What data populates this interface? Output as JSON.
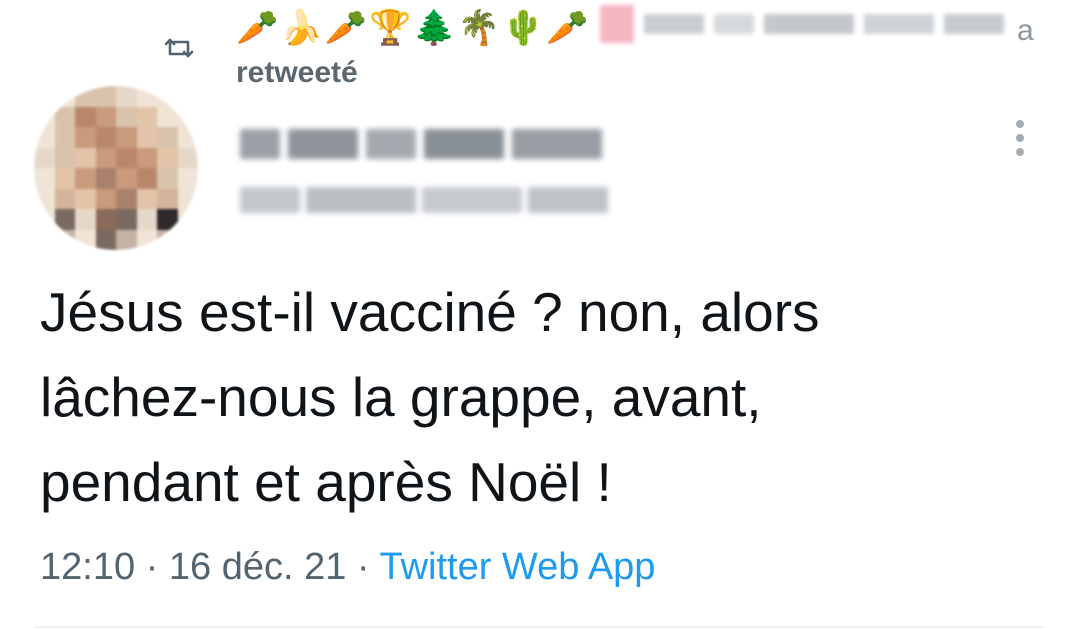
{
  "retweet": {
    "emoji_string": "🥕🍌🥕🏆🌲🌴🌵🥕",
    "tail_letter": "a",
    "label": "retweeté"
  },
  "tweet": {
    "text": "Jésus est-il vacciné ? non, alors\nlâchez-nous la grappe, avant,\npendant et après Noël !",
    "time": "12:10",
    "sep1": " · ",
    "date": "16 déc. 21",
    "sep2": " · ",
    "source": "Twitter Web App"
  },
  "icons": {
    "retweet": "retweet-icon",
    "more": "more-vertical-icon"
  },
  "colors": {
    "text": "#0f1419",
    "muted": "#536471",
    "link": "#1d9bf0",
    "retweet_label": "#5b6770"
  }
}
